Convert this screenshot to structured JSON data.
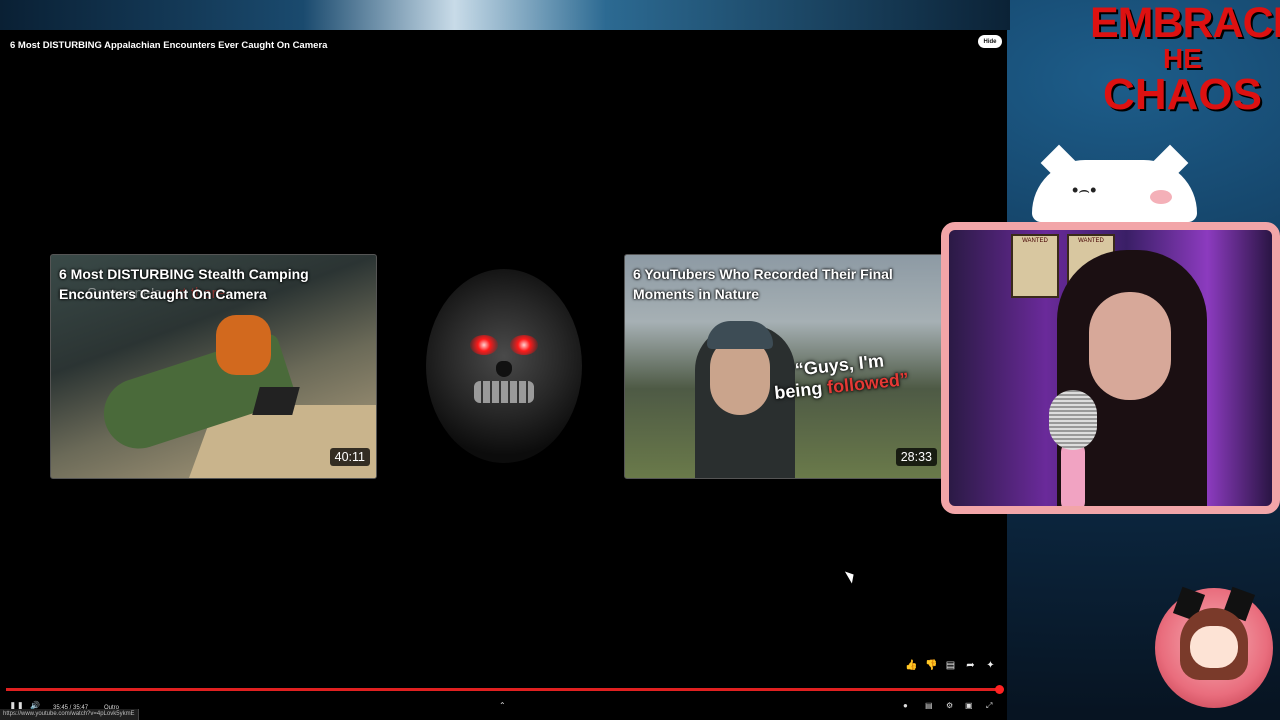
{
  "player": {
    "video_title": "6 Most DISTURBING Appalachian Encounters Ever Caught On Camera",
    "hide_label": "Hide",
    "progress_fraction": 0.997,
    "time_display": "35:45 / 35:47",
    "chapter_label": "Outro",
    "status_url": "https://www.youtube.com/watch?v=4pLovk5ykmE"
  },
  "end_cards": [
    {
      "title": "6 Most DISTURBING Stealth Camping Encounters Caught On Camera",
      "duration": "40:11",
      "overlay_text": "Someone's",
      "overlay_red": "out there..."
    },
    {
      "title": "6 YouTubers Who Recorded Their Final Moments in Nature",
      "duration": "28:33",
      "quote_line1": "“Guys, I'm",
      "quote_line2a": "being ",
      "quote_line2b": "followed”"
    }
  ],
  "actions": [
    "like-icon",
    "dislike-icon",
    "comment-icon",
    "share-icon",
    "sparkle-icon"
  ],
  "overlay": {
    "logo_line1": "EMBRACE",
    "logo_line2": "HE",
    "logo_line3": "CHAOS",
    "cat_face": "•⌢•",
    "poster1": "WANTED",
    "poster2": "WANTED"
  },
  "colors": {
    "progress": "#e02020",
    "frame": "#f2a5a8",
    "logo": "#d11111"
  }
}
